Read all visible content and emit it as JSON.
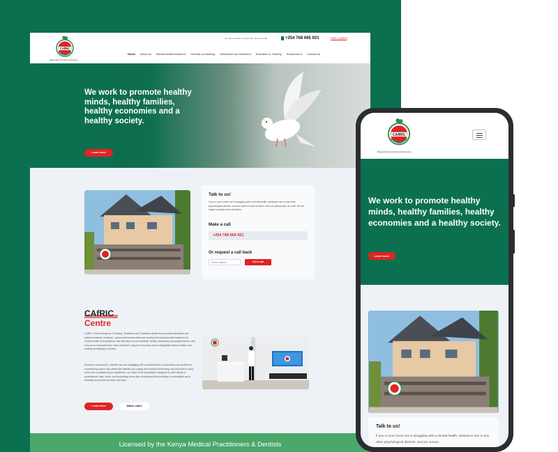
{
  "desktop": {
    "logo": {
      "name": "CAfRIC",
      "caption": "Responsible And Informed Recovery"
    },
    "header": {
      "topline": "You are not alone, we can help. Give us a call",
      "phone": "+254 768 665 921",
      "refer_link": "Refer a patient"
    },
    "nav": {
      "items": [
        {
          "label": "Home",
          "active": true
        },
        {
          "label": "About us"
        },
        {
          "label": "Mental health treatment"
        },
        {
          "label": "General counselling"
        },
        {
          "label": "Substance use treatment"
        },
        {
          "label": "Education & Training"
        },
        {
          "label": "Resources ▾"
        },
        {
          "label": "Contact us"
        }
      ]
    },
    "hero": {
      "title": "We work to promote healthy minds, healthy families, healthy economies and a healthy society.",
      "button": "Learn more"
    },
    "talk": {
      "title": "Talk to us!",
      "text": "If you or your loved one is struggling with a mental health, substance use or any other psychological distress, and are unsure of who to talk to and how, please give us a call. We are happy to answer your questions.",
      "make_call": "Make a call",
      "phone": "+254 768 665 921",
      "request_label": "Or request a call back",
      "input_placeholder": "Phone number",
      "submit": "Get a call"
    },
    "centre": {
      "title_line1": "CAfRIC",
      "title_line2": "Centre",
      "p1": "CAfRIC Centre Kenya is a Training, Treatment and Transition center that provides education and patient-centered, evidence - based and trauma-informed medical and psychosocial treatment for mental health and substance use disorders on an individual, family, community and system levels; with a focus on empowerment, harm-reduction, long-term recovery and re-integration back to stable and healthy functioning in society.",
      "p2": "Everyone is welcome! -whether you are struggling with a mental illness, a substance use problem or experiencing day to day stress that affects your coping and healthy functioning, and just want to relax, reset and re-establish your equilibrium; our state of the art facility is designed to offer clients a professional, safe, clean, and welcoming home-like environment that provides a comfortable and a relaxing environment to learn and heal.",
      "learn_more": "Learn more",
      "watch_video": "Watch video"
    },
    "footer": {
      "text": "Licensed by the Kenya Medical Practitioners & Dentists"
    }
  },
  "mobile": {
    "logo": {
      "name": "CAfRIC",
      "caption": "Responsible And Informed Recovery"
    },
    "menu_icon": "hamburger-icon",
    "hero": {
      "title": "We work to promote healthy minds, healthy families, healthy economies and a healthy society.",
      "button": "Learn more"
    },
    "talk": {
      "title": "Talk to us!",
      "text": "If you or your loved one is struggling with a mental health, substance use or any other psychological distress, and are unsure"
    }
  },
  "colors": {
    "brand_green": "#0b7050",
    "accent_red": "#e02424",
    "footer_green": "#4aa86b",
    "page_bg": "#eef2f6"
  }
}
